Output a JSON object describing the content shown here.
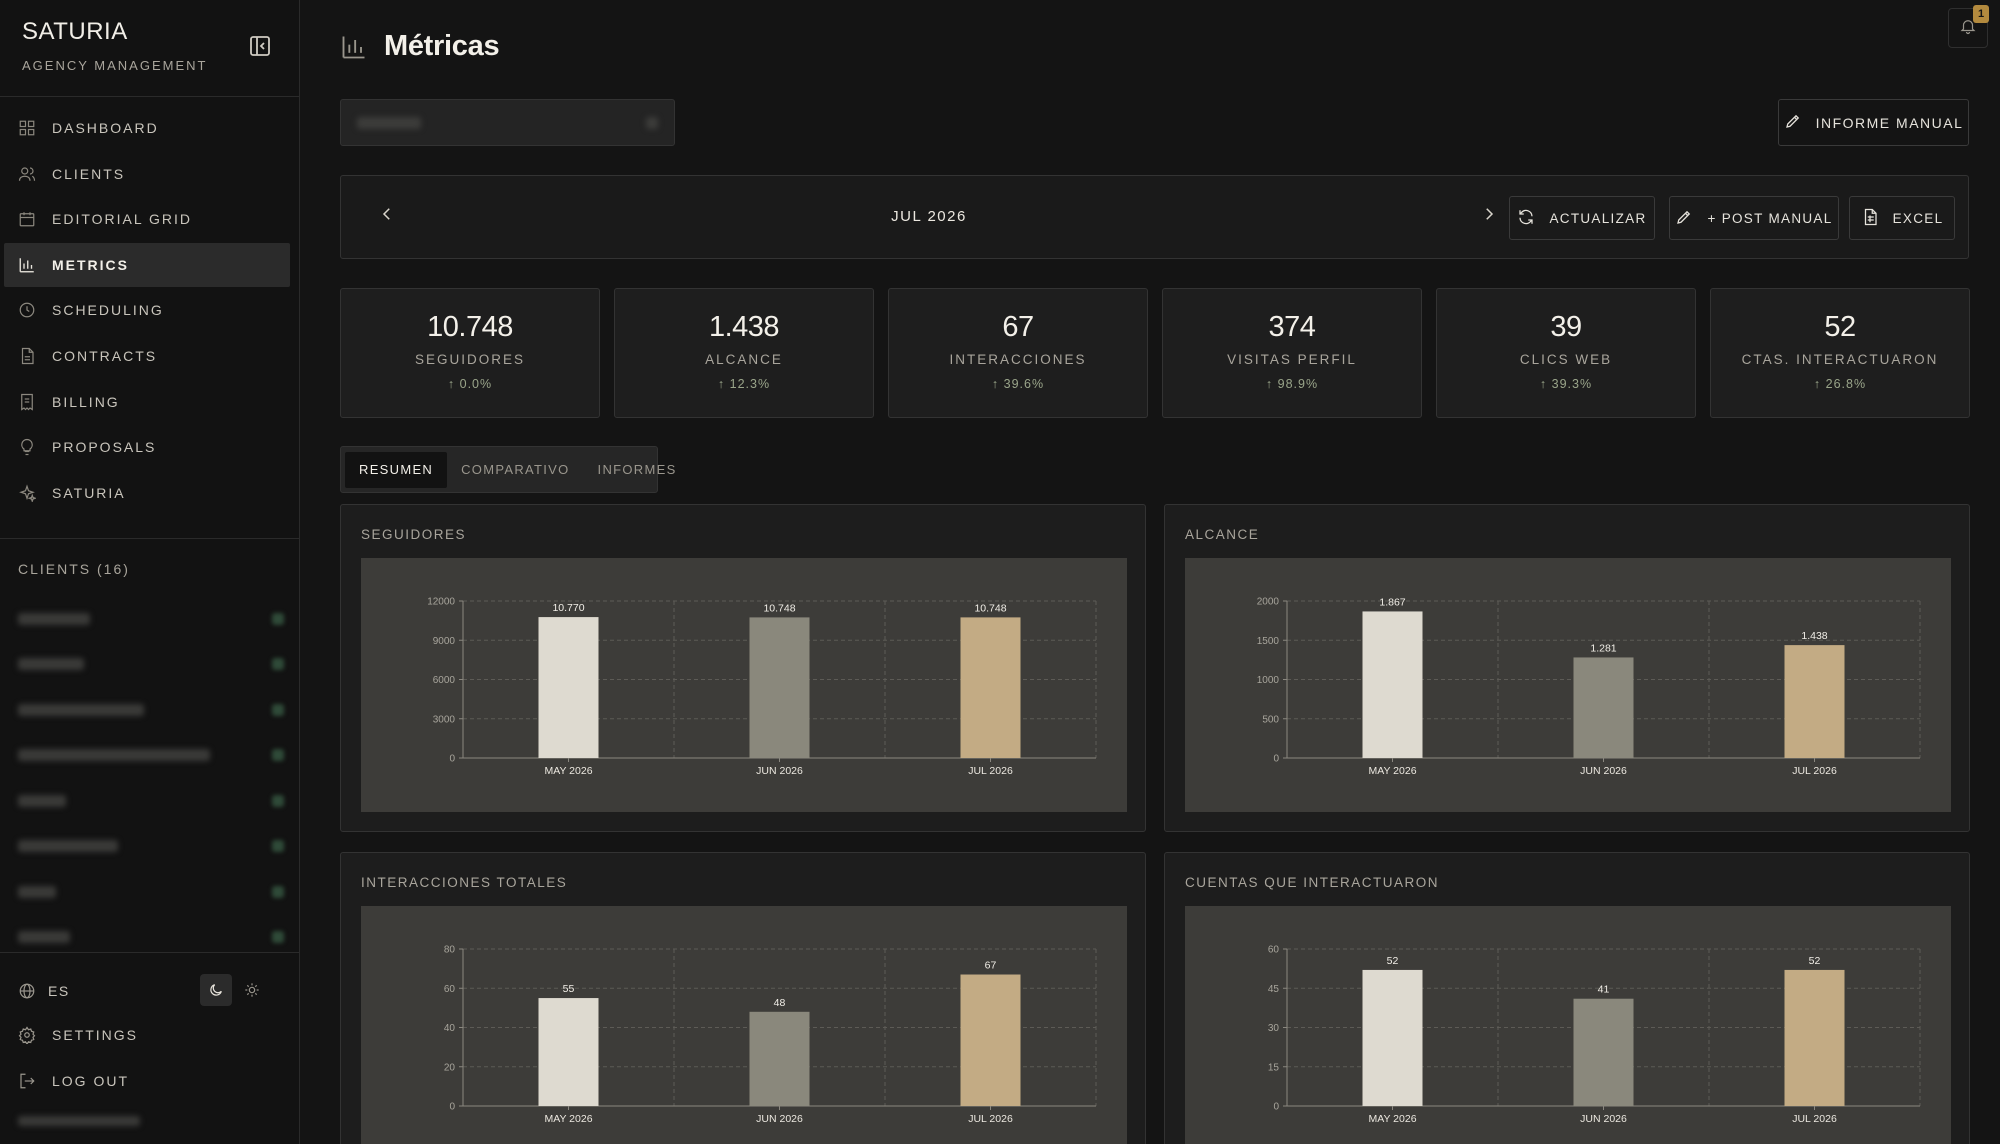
{
  "sidebar": {
    "brand": "SATURIA",
    "brand_sub": "AGENCY MANAGEMENT",
    "nav": [
      {
        "label": "DASHBOARD",
        "icon": "dashboard-icon"
      },
      {
        "label": "CLIENTS",
        "icon": "users-icon"
      },
      {
        "label": "EDITORIAL GRID",
        "icon": "calendar-icon"
      },
      {
        "label": "METRICS",
        "icon": "bar-chart-icon",
        "active": true
      },
      {
        "label": "SCHEDULING",
        "icon": "clock-icon"
      },
      {
        "label": "CONTRACTS",
        "icon": "document-icon"
      },
      {
        "label": "BILLING",
        "icon": "receipt-icon"
      },
      {
        "label": "PROPOSALS",
        "icon": "lightbulb-icon"
      },
      {
        "label": "SATURIA",
        "icon": "sparkles-icon"
      }
    ],
    "clients_heading": "CLIENTS (16)",
    "language": "ES",
    "settings_label": "SETTINGS",
    "logout_label": "LOG OUT"
  },
  "header": {
    "title": "Métricas",
    "notification_count": "1"
  },
  "toolbar": {
    "informe_manual_label": "INFORME MANUAL",
    "month": "JUL 2026",
    "actualizar_label": "ACTUALIZAR",
    "post_manual_label": "+ POST MANUAL",
    "excel_label": "EXCEL"
  },
  "kpis": [
    {
      "value": "10.748",
      "label": "SEGUIDORES",
      "change": "↑ 0.0%"
    },
    {
      "value": "1.438",
      "label": "ALCANCE",
      "change": "↑ 12.3%"
    },
    {
      "value": "67",
      "label": "INTERACCIONES",
      "change": "↑ 39.6%"
    },
    {
      "value": "374",
      "label": "VISITAS PERFIL",
      "change": "↑ 98.9%"
    },
    {
      "value": "39",
      "label": "CLICS WEB",
      "change": "↑ 39.3%"
    },
    {
      "value": "52",
      "label": "CTAS. INTERACTUARON",
      "change": "↑ 26.8%"
    }
  ],
  "tabs": [
    {
      "label": "RESUMEN",
      "active": true
    },
    {
      "label": "COMPARATIVO"
    },
    {
      "label": "INFORMES"
    }
  ],
  "colors": {
    "bar_may": "#dedad0",
    "bar_jun": "#8a887c",
    "bar_jul": "#c3ab84",
    "accent": "#b38a3e",
    "positive": "#9aa58a"
  },
  "chart_data": [
    {
      "type": "bar",
      "title": "SEGUIDORES",
      "categories": [
        "MAY 2026",
        "JUN 2026",
        "JUL 2026"
      ],
      "values": [
        10770,
        10748,
        10748
      ],
      "value_labels": [
        "10.770",
        "10.748",
        "10.748"
      ],
      "yticks": [
        "0",
        "3000",
        "6000",
        "9000",
        "12000"
      ],
      "ylim": [
        0,
        12000
      ],
      "grid": true
    },
    {
      "type": "bar",
      "title": "ALCANCE",
      "categories": [
        "MAY 2026",
        "JUN 2026",
        "JUL 2026"
      ],
      "values": [
        1867,
        1281,
        1438
      ],
      "value_labels": [
        "1.867",
        "1.281",
        "1.438"
      ],
      "yticks": [
        "0",
        "500",
        "1000",
        "1500",
        "2000"
      ],
      "ylim": [
        0,
        2000
      ],
      "grid": true
    },
    {
      "type": "bar",
      "title": "INTERACCIONES TOTALES",
      "categories": [
        "MAY 2026",
        "JUN 2026",
        "JUL 2026"
      ],
      "values": [
        55,
        48,
        67
      ],
      "value_labels": [
        "55",
        "48",
        "67"
      ],
      "yticks": [
        "0",
        "20",
        "40",
        "60",
        "80"
      ],
      "ylim": [
        0,
        80
      ],
      "grid": true
    },
    {
      "type": "bar",
      "title": "CUENTAS QUE INTERACTUARON",
      "categories": [
        "MAY 2026",
        "JUN 2026",
        "JUL 2026"
      ],
      "values": [
        52,
        41,
        52
      ],
      "value_labels": [
        "52",
        "41",
        "52"
      ],
      "yticks": [
        "0",
        "15",
        "30",
        "45",
        "60"
      ],
      "ylim": [
        0,
        60
      ],
      "grid": true
    }
  ]
}
